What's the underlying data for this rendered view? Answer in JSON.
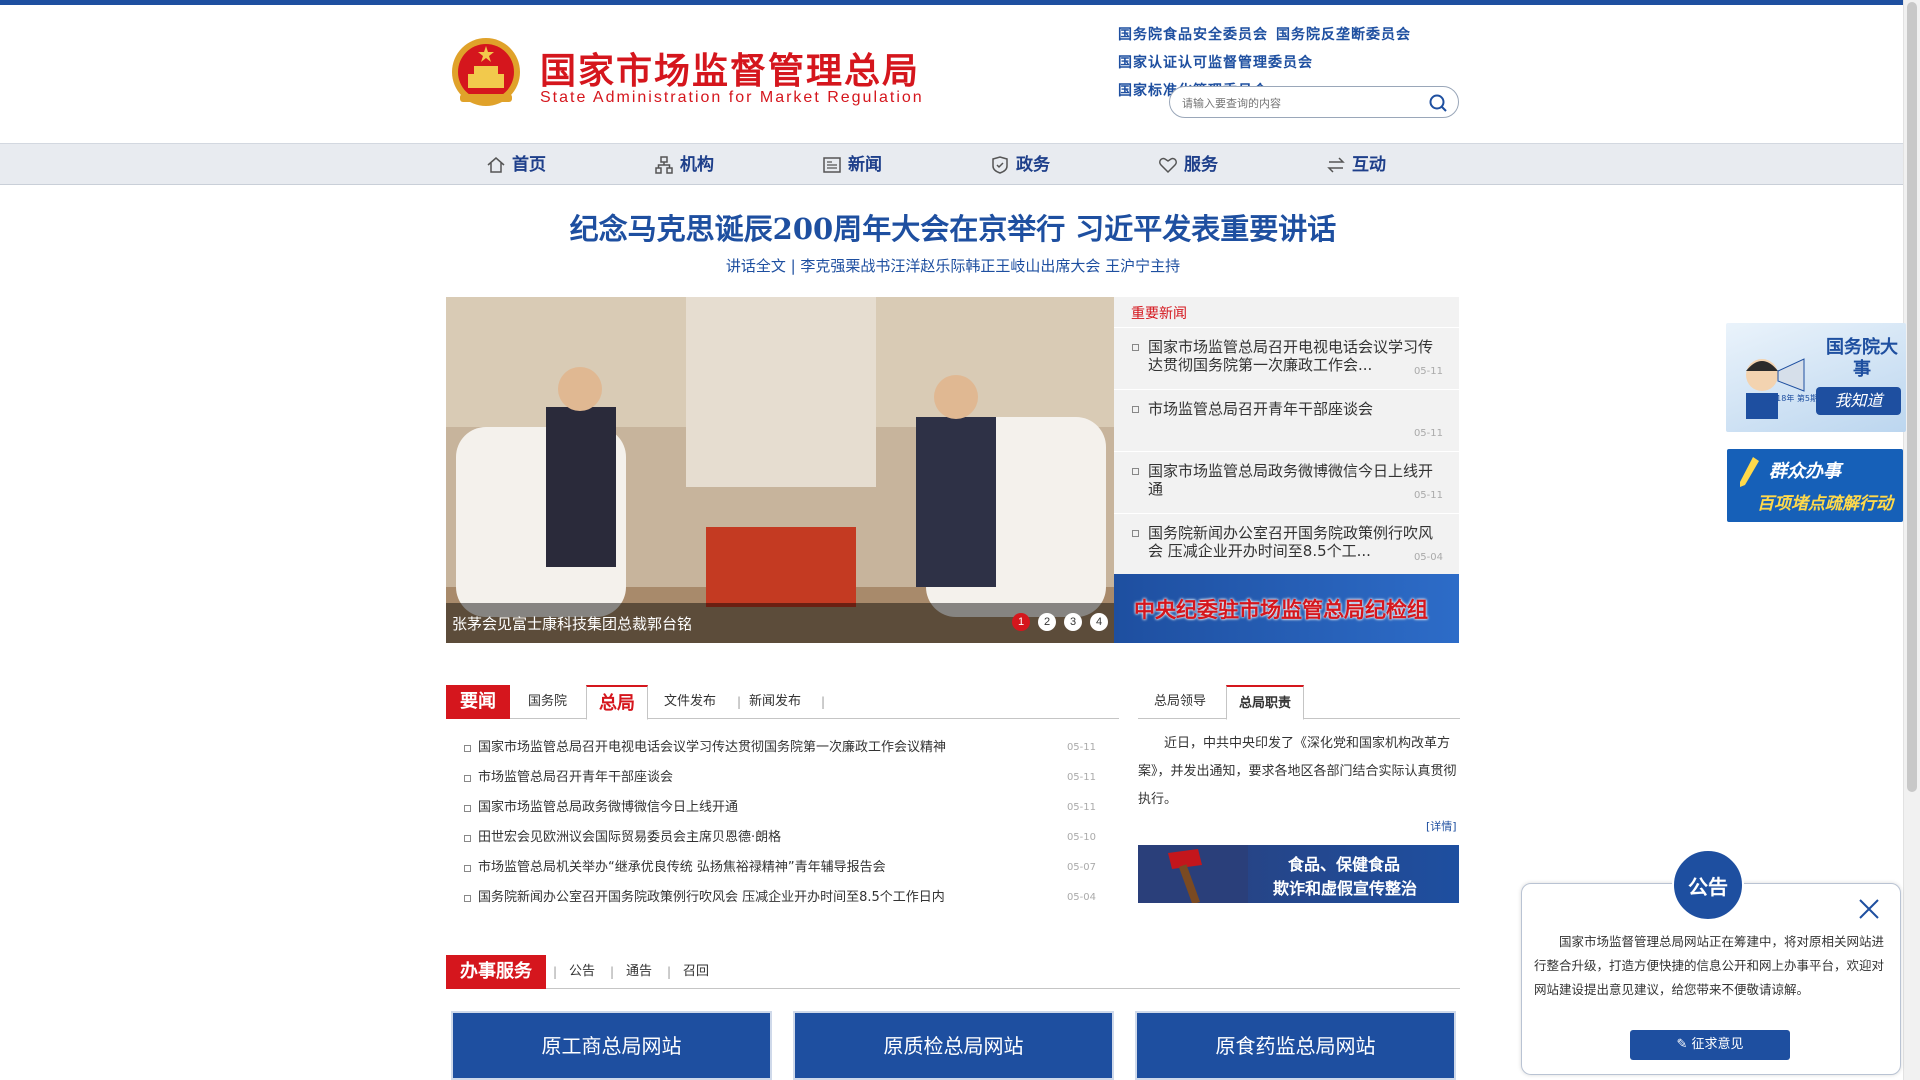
{
  "header": {
    "logo_cn": "国家市场监督管理总局",
    "logo_en": "State Administration for Market Regulation",
    "links": [
      "国务院食品安全委员会",
      "国务院反垄断委员会",
      "国家认证认可监督管理委员会",
      "国家标准化管理委员会"
    ],
    "search_placeholder": "请输入要查询的内容"
  },
  "nav": {
    "items": [
      {
        "label": "首页",
        "icon": "home-icon"
      },
      {
        "label": "机构",
        "icon": "org-icon"
      },
      {
        "label": "新闻",
        "icon": "news-icon"
      },
      {
        "label": "政务",
        "icon": "gov-icon"
      },
      {
        "label": "服务",
        "icon": "heart-icon"
      },
      {
        "label": "互动",
        "icon": "exchange-icon"
      }
    ]
  },
  "headline": {
    "title": "纪念马克思诞辰200周年大会在京举行 习近平发表重要讲话",
    "subtitle": "讲话全文 | 李克强栗战书汪洋赵乐际韩正王岐山出席大会 王沪宁主持"
  },
  "slideshow": {
    "caption": "张茅会见富士康科技集团总裁郭台铭",
    "dots": [
      "1",
      "2",
      "3",
      "4"
    ],
    "active": 0
  },
  "important_news": {
    "title": "重要新闻",
    "items": [
      {
        "text": "国家市场监管总局召开电视电话会议学习传达贯彻国务院第一次廉政工作会...",
        "date": "05-11"
      },
      {
        "text": "市场监管总局召开青年干部座谈会",
        "date": "05-11"
      },
      {
        "text": "国家市场监管总局政务微博微信今日上线开通",
        "date": "05-11"
      },
      {
        "text": "国务院新闻办公室召开国务院政策例行吹风会 压减企业开办时间至8.5个工...",
        "date": "05-04"
      }
    ],
    "banner": "中央纪委驻市场监管总局纪检组"
  },
  "side_ads": {
    "ad1_title": "国务院大事",
    "ad1_tag": "我知道",
    "ad1_small": "2018年 第5期",
    "ad2_line1": "群众办事",
    "ad2_line2": "百项堵点疏解行动"
  },
  "news_tabs": {
    "tabs": [
      "要闻",
      "国务院",
      "总局",
      "文件发布",
      "新闻发布"
    ],
    "active": 2,
    "items": [
      {
        "text": "国家市场监管总局召开电视电话会议学习传达贯彻国务院第一次廉政工作会议精神",
        "date": "05-11"
      },
      {
        "text": "市场监管总局召开青年干部座谈会",
        "date": "05-11"
      },
      {
        "text": "国家市场监管总局政务微博微信今日上线开通",
        "date": "05-11"
      },
      {
        "text": "田世宏会见欧洲议会国际贸易委员会主席贝恩德·朗格",
        "date": "05-10"
      },
      {
        "text": "市场监管总局机关举办“继承优良传统 弘扬焦裕禄精神”青年辅导报告会",
        "date": "05-07"
      },
      {
        "text": "国务院新闻办公室召开国务院政策例行吹风会 压减企业开办时间至8.5个工作日内",
        "date": "05-04"
      }
    ]
  },
  "leader_tabs": {
    "tabs": [
      "总局领导",
      "总局职责"
    ],
    "active": 1,
    "duty_text": "近日，中共中央印发了《深化党和国家机构改革方案》，并发出通知，要求各地区各部门结合实际认真贯彻执行。",
    "detail": "[详情]",
    "food_line1": "食品、保健食品",
    "food_line2": "欺诈和虚假宣传整治"
  },
  "service": {
    "tabs": [
      "办事服务",
      "公告",
      "通告",
      "召回"
    ],
    "cards": [
      "原工商总局网站",
      "原质检总局网站",
      "原食药监总局网站"
    ]
  },
  "notice": {
    "badge": "公告",
    "text": "国家市场监督管理总局网站正在筹建中，将对原相关网站进行整合升级，打造方便快捷的信息公开和网上办事平台，欢迎对网站建设提出意见建议，给您带来不便敬请谅解。",
    "button": "征求意见"
  },
  "colors": {
    "brand_blue": "#1e4fa0",
    "brand_red": "#d5161d"
  }
}
